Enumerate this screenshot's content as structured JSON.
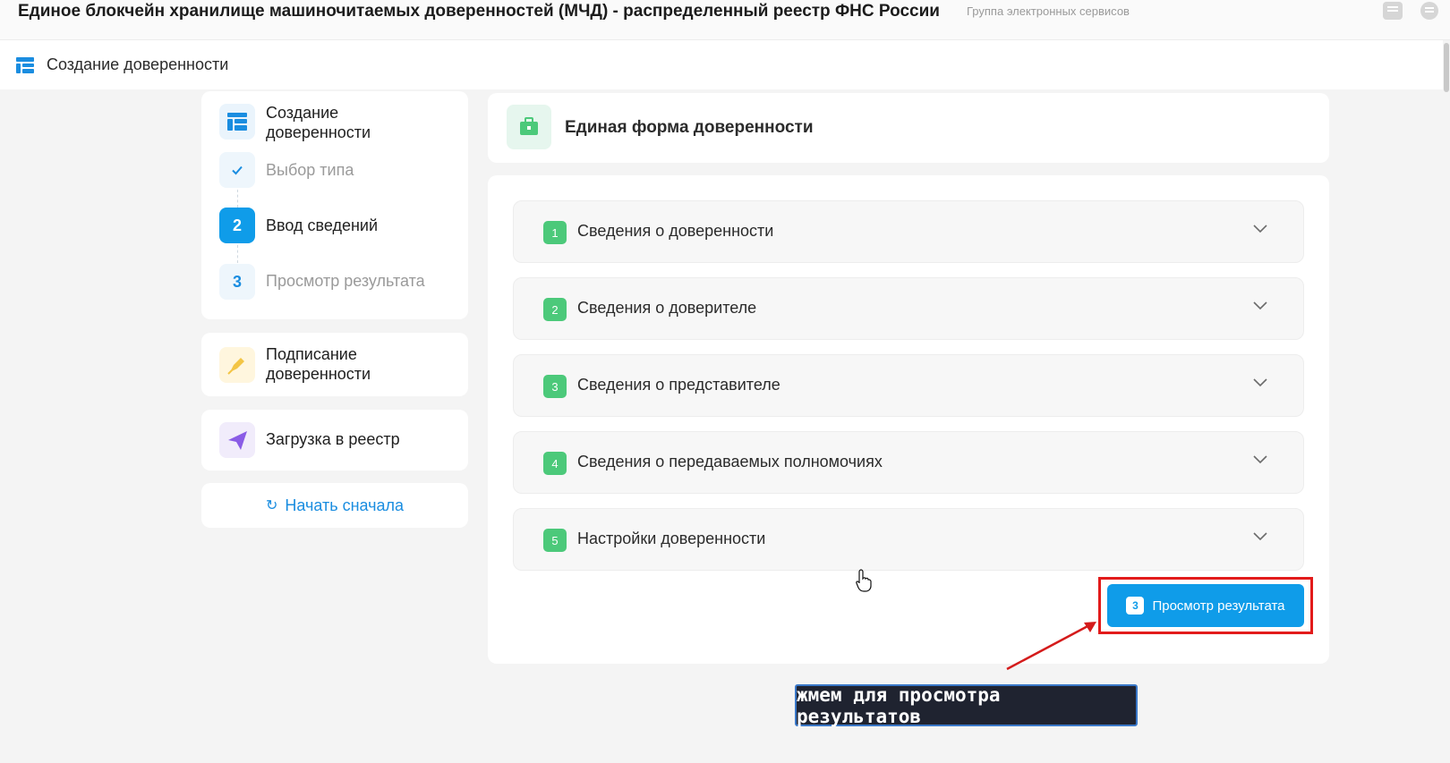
{
  "header": {
    "title": "Единое блокчейн хранилище машиночитаемых доверенностей (МЧД) - распределенный реестр ФНС России",
    "org": "Группа электронных сервисов",
    "icons": [
      "chat-icon",
      "menu-icon"
    ]
  },
  "subheader": {
    "label": "Создание доверенности",
    "icon": "table-icon"
  },
  "sidebar": {
    "create": {
      "title": "Создание доверенности",
      "steps": [
        {
          "badge": "✓",
          "label": "Выбор типа",
          "state": "done"
        },
        {
          "badge": "2",
          "label": "Ввод сведений",
          "state": "active"
        },
        {
          "badge": "3",
          "label": "Просмотр результата",
          "state": "pending"
        }
      ]
    },
    "sign": {
      "title": "Подписание доверенности",
      "icon": "pen-icon"
    },
    "upload": {
      "title": "Загрузка в реестр",
      "icon": "send-icon"
    },
    "restart": {
      "label": "Начать сначала",
      "icon": "refresh-icon"
    }
  },
  "main": {
    "title": "Единая форма доверенности",
    "sections": [
      {
        "num": "1",
        "title": "Сведения о доверенности"
      },
      {
        "num": "2",
        "title": "Сведения о доверителе"
      },
      {
        "num": "3",
        "title": "Сведения о представителе"
      },
      {
        "num": "4",
        "title": "Сведения о передаваемых полномочиях"
      },
      {
        "num": "5",
        "title": "Настройки доверенности"
      }
    ],
    "view_button": {
      "num": "3",
      "label": "Просмотр результата"
    }
  },
  "annotation": {
    "caption": "жмем для просмотра результатов"
  },
  "colors": {
    "accent": "#0f9ce9",
    "success": "#4cc97a",
    "highlight": "#e21b1b"
  }
}
